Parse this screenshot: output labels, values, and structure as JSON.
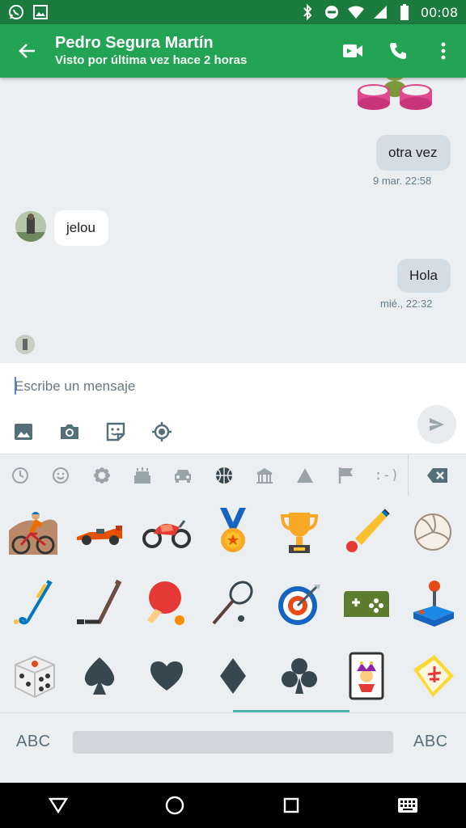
{
  "status_bar": {
    "time": "00:08",
    "left_icons": [
      "whatsapp-icon",
      "image-icon"
    ],
    "right_icons": [
      "bluetooth-icon",
      "do-not-disturb-icon",
      "wifi-icon",
      "signal-icon",
      "battery-icon"
    ]
  },
  "header": {
    "contact_name": "Pedro Segura Martín",
    "last_seen": "Visto por última vez hace 2 horas",
    "colors": {
      "status_bar": "#1b7a3d",
      "app_bar": "#23a455"
    }
  },
  "messages": [
    {
      "type": "sticker",
      "direction": "out",
      "description": "drummer-sticker"
    },
    {
      "type": "text",
      "direction": "out",
      "text": "otra vez",
      "timestamp": "9 mar. 22:58"
    },
    {
      "type": "text",
      "direction": "in",
      "text": "jelou"
    },
    {
      "type": "text",
      "direction": "out",
      "text": "Hola",
      "timestamp": "mié., 22:32"
    }
  ],
  "composer": {
    "placeholder": "Escribe un mensaje",
    "tools": [
      "image-icon",
      "camera-icon",
      "sticker-icon",
      "location-icon"
    ]
  },
  "emoji_categories": [
    "recent-icon",
    "smiley-icon",
    "flower-icon",
    "cake-icon",
    "car-icon",
    "basketball-icon",
    "building-icon",
    "triangle-icon",
    "flag-icon",
    "emoticon-icon"
  ],
  "emoticon_label": ":-)",
  "active_category": "basketball-icon",
  "emojis": [
    "cyclist-emoji",
    "race-car-emoji",
    "motorcycle-emoji",
    "medal-emoji",
    "trophy-emoji",
    "cricket-emoji",
    "volleyball-emoji",
    "field-hockey-emoji",
    "ice-hockey-emoji",
    "ping-pong-emoji",
    "badminton-emoji",
    "dart-target-emoji",
    "game-controller-emoji",
    "joystick-emoji",
    "dice-emoji",
    "spade-emoji",
    "heart-suit-emoji",
    "diamond-suit-emoji",
    "club-emoji",
    "joker-card-emoji",
    "mahjong-emoji"
  ],
  "keyboard": {
    "left_label": "ABC",
    "right_label": "ABC"
  }
}
